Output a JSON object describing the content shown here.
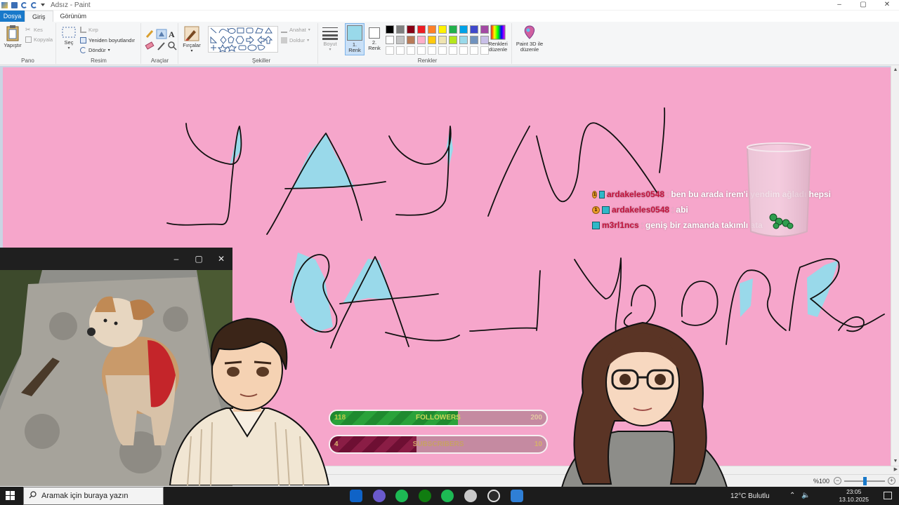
{
  "window": {
    "title": "Adsız - Paint",
    "controls": [
      "–",
      "▢",
      "✕"
    ]
  },
  "tabs": [
    {
      "label": "Dosya"
    },
    {
      "label": "Giriş"
    },
    {
      "label": "Görünüm"
    }
  ],
  "ribbon": {
    "clipboard": {
      "paste": "Yapıştır",
      "cut": "Kes",
      "copy": "Kopyala",
      "group": "Pano"
    },
    "image": {
      "select": "Seç",
      "crop": "Kırp",
      "resize": "Yeniden boyutlandır",
      "rotate": "Döndür",
      "group": "Resim"
    },
    "tools": {
      "group": "Araçlar"
    },
    "brushes": {
      "label": "Fırçalar"
    },
    "shapes": {
      "outline": "Anahat",
      "fill": "Doldur",
      "group": "Şekiller"
    },
    "size": {
      "label": "Boyut"
    },
    "color1": {
      "label": "1.",
      "label2": "Renk"
    },
    "color2": {
      "label": "2.",
      "label2": "Renk"
    },
    "colors": {
      "group": "Renkler",
      "edit_label": "Renkleri",
      "edit_label2": "düzenle"
    },
    "paint3d": {
      "label": "Paint 3D ile",
      "label2": "düzenle"
    },
    "palette_row1": [
      "#000000",
      "#7f7f7f",
      "#880015",
      "#ed1c24",
      "#ff7f27",
      "#fff200",
      "#22b14c",
      "#00a2e8",
      "#3f48cc",
      "#a349a4"
    ],
    "palette_row2": [
      "#ffffff",
      "#c3c3c3",
      "#b97a57",
      "#ffaec9",
      "#ffc90e",
      "#efe4b0",
      "#b5e61d",
      "#99d9ea",
      "#7092be",
      "#c8bfe7"
    ],
    "active_color1": "#99d9ea",
    "active_color2": "#ffffff"
  },
  "canvas": {
    "background": "#f6a6cb",
    "brush_color": "#99d9ea"
  },
  "chat": [
    {
      "user": "ardakeles0548",
      "message": "ben bu arada irem'i yendim ağladı hepsi",
      "badge": "1"
    },
    {
      "user": "ardakeles0548",
      "message": "abi",
      "badge": "1"
    },
    {
      "user": "m3rl1ncs",
      "message": "geniş bir zamanda takımlı ata"
    }
  ],
  "goals": {
    "followers": {
      "current": "118",
      "label": "FOLLOWERS",
      "target": "200",
      "progress": 0.59
    },
    "subscribers": {
      "current": "4",
      "label": "SUBSCRIBERS",
      "target": "10",
      "progress": 0.4
    }
  },
  "camera_window": {
    "controls": [
      "–",
      "▢",
      "✕"
    ]
  },
  "statusbar": {
    "zoom": "%100"
  },
  "taskbar": {
    "search_placeholder": "Aramak için buraya yazın",
    "weather": "12°C  Bulutlu",
    "time": "23:05",
    "date": "13.10.2025"
  }
}
